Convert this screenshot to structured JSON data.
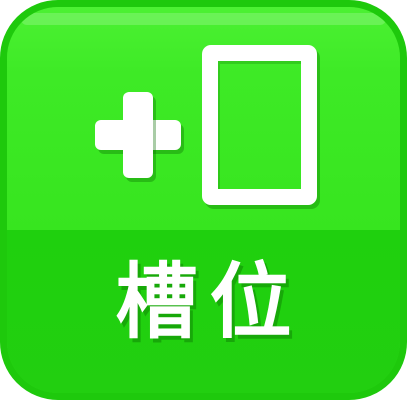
{
  "button": {
    "label": "槽位",
    "icons": [
      "plus-icon",
      "card-slot-icon"
    ],
    "colors": {
      "base": "#2cdd17",
      "top": "#3eea26",
      "bottom": "#22cf10",
      "border": "#1ec90c",
      "foreground": "#ffffff"
    }
  }
}
